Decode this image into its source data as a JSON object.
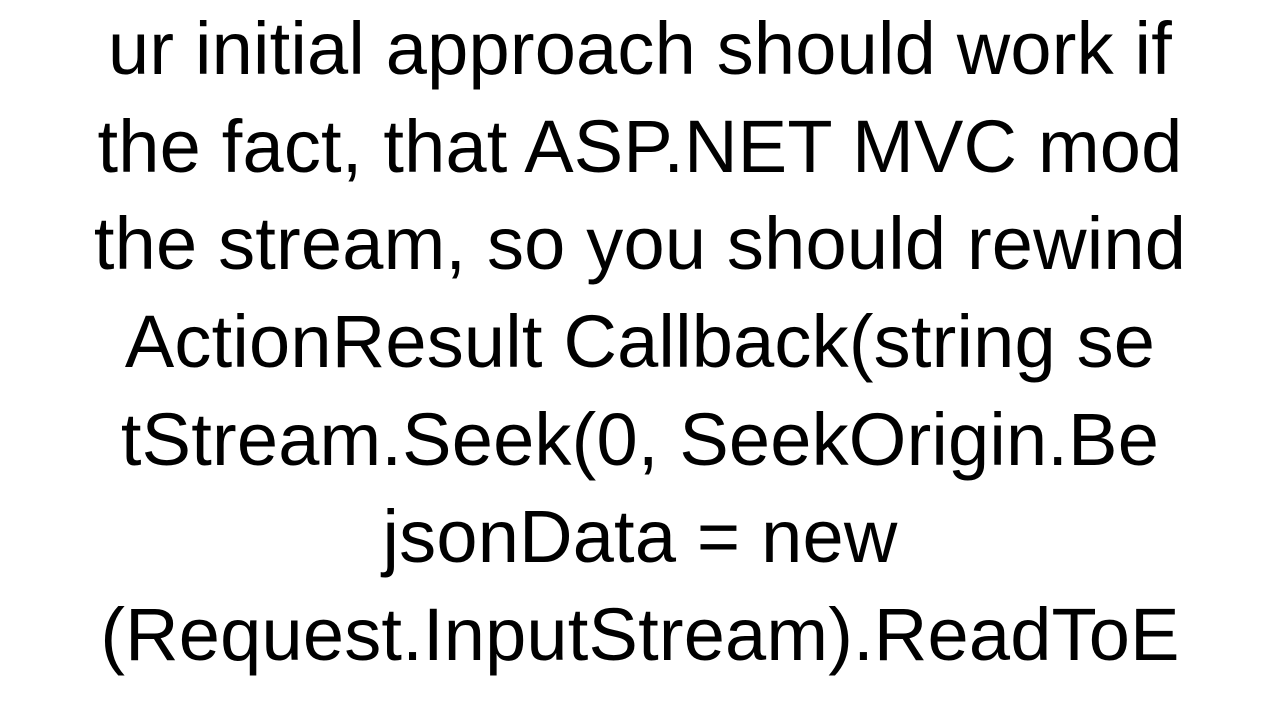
{
  "lines": [
    "ur initial approach should work if",
    "the fact, that ASP.NET MVC mod",
    "the stream, so you should rewind",
    " ActionResult Callback(string se",
    "tStream.Seek(0, SeekOrigin.Be",
    "jsonData = new",
    "(Request.InputStream).ReadToE"
  ]
}
